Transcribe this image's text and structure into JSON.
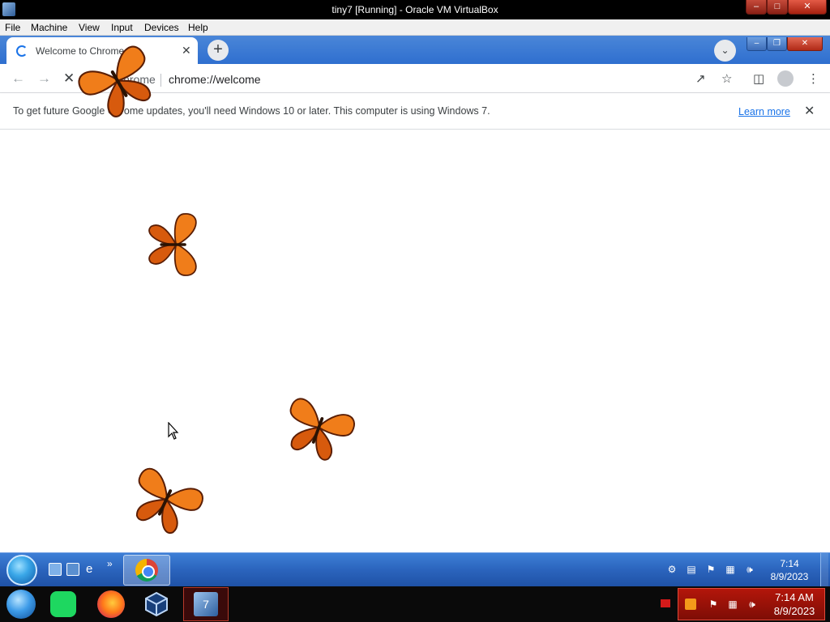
{
  "vbox": {
    "window_title": "tiny7 [Running] - Oracle VM VirtualBox",
    "menu": [
      "File",
      "Machine",
      "View",
      "Input",
      "Devices",
      "Help"
    ]
  },
  "chrome": {
    "tab_title": "Welcome to Chrome",
    "omnibox_label": "Chrome",
    "url": "chrome://welcome",
    "infobar_message": "To get future Google Chrome updates, you'll need Windows 10 or later. This computer is using Windows 7.",
    "learn_more": "Learn more"
  },
  "guest_taskbar": {
    "time": "7:14",
    "date": "8/9/2023"
  },
  "host_taskbar": {
    "time": "7:14 AM",
    "date": "8/9/2023"
  },
  "colors": {
    "accent": "#1a73e8",
    "tabstrip": "#2f6fcf",
    "butterfly": "#f07d1a",
    "host_tray": "#b3160a"
  }
}
